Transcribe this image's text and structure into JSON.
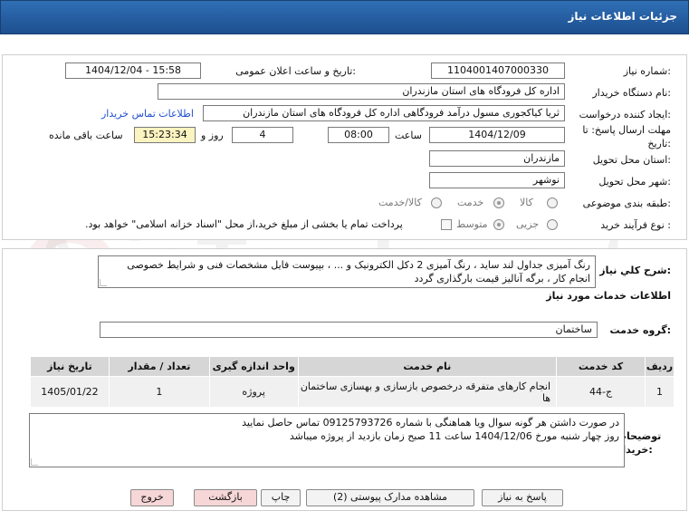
{
  "header": {
    "title": "جزئیات اطلاعات نیاز"
  },
  "details": {
    "need_number_label": "شماره نیاز:",
    "need_number": "1104001407000330",
    "announce_label": "تاریخ و ساعت اعلان عمومی:",
    "announce_value": "1404/12/04 - 15:58",
    "buyer_org_label": "نام دستگاه خریدار:",
    "buyer_org": "اداره کل فرودگاه های استان مازندران",
    "creator_label": "ایجاد کننده درخواست:",
    "creator": "ثریا کیاکجوری مسول درآمد فرودگاهی اداره کل فرودگاه های استان مازندران",
    "contact_link": "اطلاعات تماس خریدار",
    "deadline_label": "مهلت ارسال پاسخ: تا تاریخ:",
    "deadline_date": "1404/12/09",
    "time_label": "ساعت",
    "deadline_time": "08:00",
    "days": "4",
    "days_label": "روز و",
    "remaining_time": "15:23:34",
    "remaining_label": "ساعت باقی مانده",
    "province_label": "استان محل تحویل:",
    "province": "مازندران",
    "city_label": "شهر محل تحویل:",
    "city": "نوشهر",
    "category_label": "طبقه بندی موضوعی:",
    "category_options": [
      "کالا",
      "خدمت",
      "کالا/خدمت"
    ],
    "process_label": "نوع فرآیند خرید :",
    "process_options": [
      "جزیی",
      "متوسط"
    ],
    "payment_note": "پرداخت تمام یا بخشی از مبلغ خرید،از محل \"اسناد خزانه اسلامی\" خواهد بود."
  },
  "general": {
    "desc_label": "شرح کلي نياز:",
    "description": "رنگ آمیزی جداول لند ساید ، رنگ آمیزی 2 دکل الکترونیک و ... ، بپیوست فایل مشخصات فنی و شرایط خصوصی انجام کار ، برگه آنالیز قیمت بارگذاری گردد",
    "services_title": "اطلاعات خدمات مورد نياز",
    "group_label": "گروه خدمت:",
    "group_value": "ساختمان"
  },
  "table": {
    "headers": [
      "ردیف",
      "کد خدمت",
      "نام خدمت",
      "واحد اندازه گیری",
      "تعداد / مقدار",
      "تاریخ نیاز"
    ],
    "rows": [
      [
        "1",
        "ج-44",
        "انجام کارهای متفرقه درخصوص بازسازی و بهسازی ساختمان ها",
        "پروژه",
        "1",
        "1405/01/22"
      ]
    ]
  },
  "notes": {
    "label": "توضیحات خریدار:",
    "line1": "در صورت داشتن هر گونه سوال ویا هماهنگی با شماره 09125793726 تماس حاصل نمایید",
    "line2": "روز چهار شنبه مورخ 1404/12/06 ساعت 11 صبح زمان بازدید از پروژه میباشد"
  },
  "buttons": {
    "reply": "پاسخ به نیاز",
    "docs": "مشاهده مدارک پیوستی (2)",
    "print": "چاپ",
    "back": "بازگشت",
    "exit": "خروج"
  },
  "watermark": "AriaTender.net"
}
